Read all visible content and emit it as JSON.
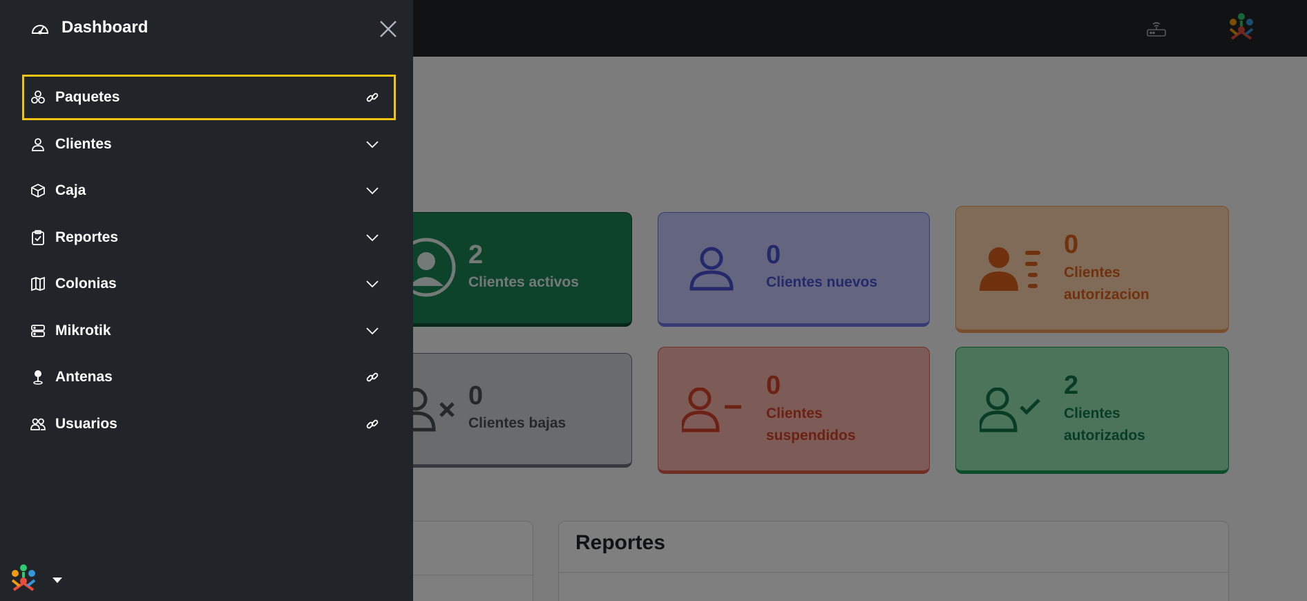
{
  "sidebar": {
    "title": "Dashboard",
    "items": [
      {
        "label": "Paquetes",
        "icon": "boxes-icon",
        "right_icon": "link-icon",
        "active": true
      },
      {
        "label": "Clientes",
        "icon": "person-icon",
        "right_icon": "chevron-down-icon"
      },
      {
        "label": "Caja",
        "icon": "box-icon",
        "right_icon": "chevron-down-icon"
      },
      {
        "label": "Reportes",
        "icon": "clipboard-check-icon",
        "right_icon": "chevron-down-icon"
      },
      {
        "label": "Colonias",
        "icon": "map-icon",
        "right_icon": "chevron-down-icon"
      },
      {
        "label": "Mikrotik",
        "icon": "server-icon",
        "right_icon": "chevron-down-icon"
      },
      {
        "label": "Antenas",
        "icon": "pin-icon",
        "right_icon": "link-icon"
      },
      {
        "label": "Usuarios",
        "icon": "people-icon",
        "right_icon": "link-icon"
      }
    ]
  },
  "cards": {
    "activos": {
      "value": "2",
      "label": "Clientes activos"
    },
    "nuevos": {
      "value": "0",
      "label": "Clientes nuevos"
    },
    "autorizacion": {
      "value": "0",
      "label_line1": "Clientes",
      "label_line2": "autorizacion"
    },
    "bajas": {
      "value": "0",
      "label": "Clientes bajas"
    },
    "suspendidos": {
      "value": "0",
      "label_line1": "Clientes",
      "label_line2": "suspendidos"
    },
    "autorizados": {
      "value": "2",
      "label_line1": "Clientes",
      "label_line2": "autorizados"
    }
  },
  "panels": {
    "reportes_title": "Reportes"
  },
  "colors": {
    "sidebar_bg": "#212529",
    "highlight": "#f1c40f",
    "activos": "#198754",
    "nuevos": "#6f75e8",
    "autorizacion": "#e0621f",
    "suspendidos": "#d8432b",
    "autorizados": "#117a47"
  }
}
